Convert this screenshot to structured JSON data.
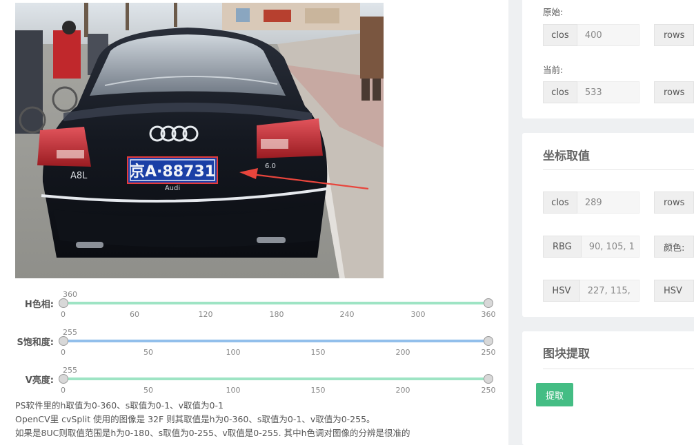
{
  "sliders": [
    {
      "label": "H色相:",
      "max_value": "360",
      "ticks": [
        "0",
        "60",
        "120",
        "180",
        "240",
        "300",
        "360"
      ],
      "color": "#9ee4c4",
      "level": 1.0
    },
    {
      "label": "S饱和度:",
      "max_value": "255",
      "ticks": [
        "0",
        "50",
        "100",
        "150",
        "200",
        "250"
      ],
      "color": "#92bfeb",
      "level": 1.0
    },
    {
      "label": "V亮度:",
      "max_value": "255",
      "ticks": [
        "0",
        "50",
        "100",
        "150",
        "200",
        "250"
      ],
      "color": "#9ee4c4",
      "level": 1.0
    }
  ],
  "notes": [
    "PS软件里的h取值为0-360、s取值为0-1、v取值为0-1",
    "OpenCV里 cvSplit 使用的图像是 32F 则其取值是h为0-360、s取值为0-1、v取值为0-255。",
    "如果是8UC则取值范围是h为0-180、s取值为0-255、v取值是0-255. 其中h色调对图像的分辨是很准的"
  ],
  "size_card": {
    "original_label": "原始:",
    "original": {
      "clos_label": "clos",
      "clos_value": "400",
      "rows_label": "rows"
    },
    "current_label": "当前:",
    "current": {
      "clos_label": "clos",
      "clos_value": "533",
      "rows_label": "rows"
    }
  },
  "coord_card": {
    "title": "坐标取值",
    "clos_label": "clos",
    "clos_value": "289",
    "rows_label": "rows",
    "rgb_label": "RBG",
    "rgb_value": "90, 105, 1",
    "color_label": "颜色:",
    "hsv_label": "HSV",
    "hsv_value": "227, 115,",
    "hsv2_label": "HSV"
  },
  "block_card": {
    "title": "图块提取",
    "button_label": "提取"
  },
  "photo": {
    "plate_text": "京A·88731",
    "car_badge": "A8L",
    "brand_text": "Audi",
    "engine_badge": "6.0"
  },
  "colors": {
    "button": "#44bd84",
    "h_track": "#9ee4c4",
    "s_track": "#92bfeb",
    "v_track": "#9ee4c4",
    "arrow": "#e8453c"
  }
}
